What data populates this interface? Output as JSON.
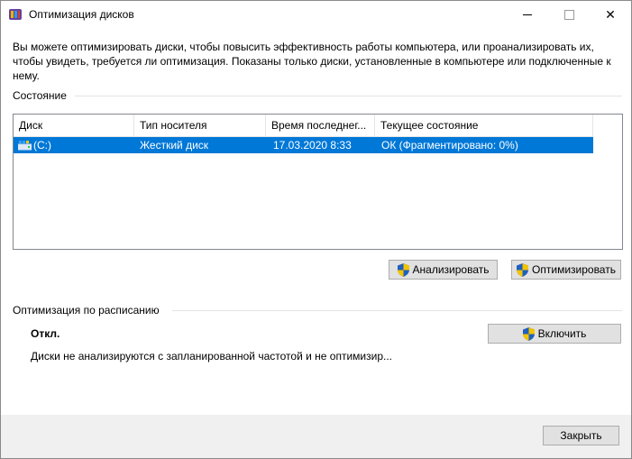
{
  "window": {
    "title": "Оптимизация дисков",
    "icon": "defrag-app-icon",
    "controls": {
      "minimize": "minimize-icon",
      "maximize": "maximize-icon",
      "close": "✕"
    }
  },
  "description": "Вы можете оптимизировать диски, чтобы повысить эффективность работы  компьютера, или проанализировать их, чтобы увидеть, требуется ли оптимизация. Показаны только диски, установленные в компьютере или подключенные к нему.",
  "status": {
    "label": "Состояние",
    "columns": [
      "Диск",
      "Тип носителя",
      "Время последнег...",
      "Текущее состояние"
    ],
    "rows": [
      {
        "drive": "(C:)",
        "media": "Жесткий диск",
        "last_run": "17.03.2020 8:33",
        "state": "ОК (Фрагментировано: 0%)",
        "icon": "hard-drive-icon",
        "selected": true
      }
    ],
    "analyze_label": "Анализировать",
    "optimize_label": "Оптимизировать"
  },
  "schedule": {
    "label": "Оптимизация по расписанию",
    "state": "Откл.",
    "description": "Диски не анализируются с запланированной частотой и не оптимизир...",
    "enable_label": "Включить"
  },
  "footer": {
    "close_label": "Закрыть"
  },
  "colors": {
    "selection": "#0078d7",
    "button_face": "#e1e1e1",
    "footer": "#f0f0f0"
  }
}
